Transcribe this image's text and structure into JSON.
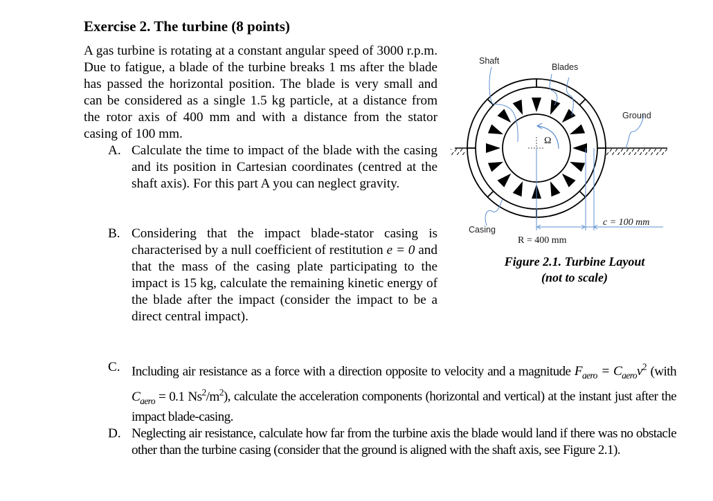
{
  "exercise": {
    "title": "Exercise 2. The turbine (8 points)",
    "intro": "A gas turbine is rotating at a constant angular speed of 3000 r.p.m. Due to fatigue, a blade of the turbine breaks 1 ms after the blade has passed the horizontal position. The blade is very small and can be considered as a single 1.5 kg particle, at a distance from the rotor axis of 400 mm and with a distance from the stator casing of 100 mm."
  },
  "questions": [
    {
      "label": "A.",
      "text": "Calculate the time to impact of the blade with the casing and its position in Cartesian coordinates (centred at the shaft axis). For this part A you can neglect gravity."
    },
    {
      "label": "B.",
      "text_before": "Considering that the impact blade-stator casing is characterised by a null coefficient of restitution ",
      "math": "e = 0",
      "text_after": " and that the mass of the casing plate participating to the impact is 15 kg, calculate the remaining kinetic energy of the blade after the impact (consider the impact to be a direct central impact)."
    },
    {
      "label": "C.",
      "text_1": "Including air resistance as a force with a direction opposite to velocity and a magnitude ",
      "formula_F": "F",
      "formula_F_sub": "aero",
      "formula_eq": " = C",
      "formula_C_sub": "aero",
      "formula_v": "v",
      "formula_v_sup": "2",
      "text_2": " (with ",
      "coef_C": "C",
      "coef_C_sub": "aero",
      "coef_value": " = 0.1 Ns",
      "coef_unit_sup1": "2",
      "coef_unit_mid": "/m",
      "coef_unit_sup2": "2",
      "text_3": "), calculate the acceleration components (horizontal and vertical) at the instant just after the impact blade-casing."
    },
    {
      "label": "D.",
      "text": "Neglecting air resistance, calculate how far from the turbine axis the blade would land if there was no obstacle other than the turbine casing (consider that the ground is aligned with the shaft axis, see Figure 2.1)."
    }
  ],
  "figure": {
    "labels": {
      "shaft": "Shaft",
      "blades": "Blades",
      "ground": "Ground",
      "casing": "Casing",
      "omega": "Ω",
      "radius": "R = 400 mm",
      "clearance": "c = 100 mm"
    },
    "blade_count": 16,
    "annotation_color": "#5b8fd0",
    "caption_line1": "Figure 2.1. Turbine Layout",
    "caption_line2": "(not to scale)"
  }
}
